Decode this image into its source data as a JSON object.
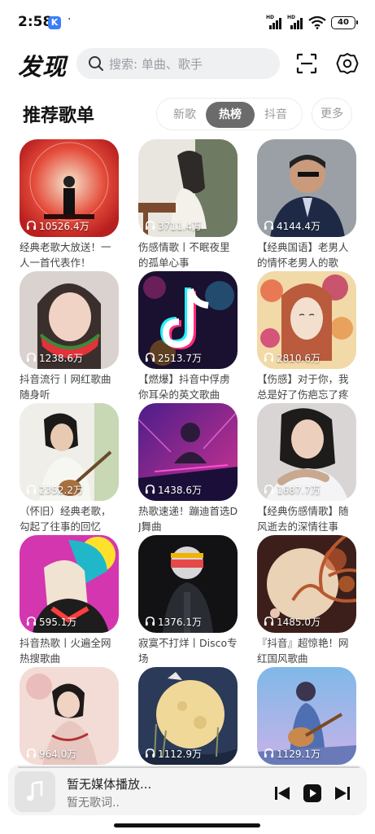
{
  "status_bar": {
    "time": "2:58",
    "app_badge": "K",
    "dot": "·",
    "signal_badge": "HD",
    "battery": "40"
  },
  "header": {
    "title": "发现",
    "search_placeholder": "搜索: 单曲、歌手"
  },
  "section": {
    "title": "推荐歌单",
    "tabs": [
      {
        "label": "新歌",
        "active": false
      },
      {
        "label": "热榜",
        "active": true
      },
      {
        "label": "抖音",
        "active": false
      }
    ],
    "more_label": "更多"
  },
  "playlists": [
    {
      "plays": "10526.4万",
      "title": "经典老歌大放送！一人一首代表作！",
      "cover": "red-concert"
    },
    {
      "plays": "3711.4万",
      "title": "伤感情歌丨不眠夜里的孤单心事",
      "cover": "piano-girl"
    },
    {
      "plays": "4144.4万",
      "title": "【经典国语】老男人的情怀老男人的歌",
      "cover": "man-suit"
    },
    {
      "plays": "1238.6万",
      "title": "抖音流行丨网红歌曲随身听",
      "cover": "watermelon-girl"
    },
    {
      "plays": "2513.7万",
      "title": "【燃爆】抖音中俘虏你耳朵的英文歌曲",
      "cover": "tiktok-neon"
    },
    {
      "plays": "2810.6万",
      "title": "【伤感】对于你，我总是好了伤疤忘了疼",
      "cover": "flower-girl"
    },
    {
      "plays": "2352.2万",
      "title": "（怀旧）经典老歌，勾起了往事的回忆",
      "cover": "guitar-woman"
    },
    {
      "plays": "1438.6万",
      "title": "热歌速递！蹦迪首选DJ舞曲",
      "cover": "dj-neon"
    },
    {
      "plays": "1687.7万",
      "title": "【经典伤感情歌】随风逝去的深情往事",
      "cover": "thinking-woman"
    },
    {
      "plays": "595.1万",
      "title": "抖音热歌丨火遍全网热搜歌曲",
      "cover": "pink-art"
    },
    {
      "plays": "1376.1万",
      "title": "寂寞不打烊丨Disco专场",
      "cover": "disco-helmet"
    },
    {
      "plays": "1485.0万",
      "title": "『抖音』超惊艳！网红国风歌曲",
      "cover": "moon-tree"
    },
    {
      "plays": "964.0万",
      "title": "",
      "cover": "dancer-pink"
    },
    {
      "plays": "1112.9万",
      "title": "",
      "cover": "moon-boy"
    },
    {
      "plays": "1129.1万",
      "title": "",
      "cover": "guitar-boy"
    }
  ],
  "player": {
    "title": "暂无媒体播放...",
    "lyric": "暂无歌词.."
  },
  "colors": {
    "active_tab": "#6b6b6b",
    "search_bg": "#eef0f2",
    "player_bg": "#f4f4f4"
  }
}
